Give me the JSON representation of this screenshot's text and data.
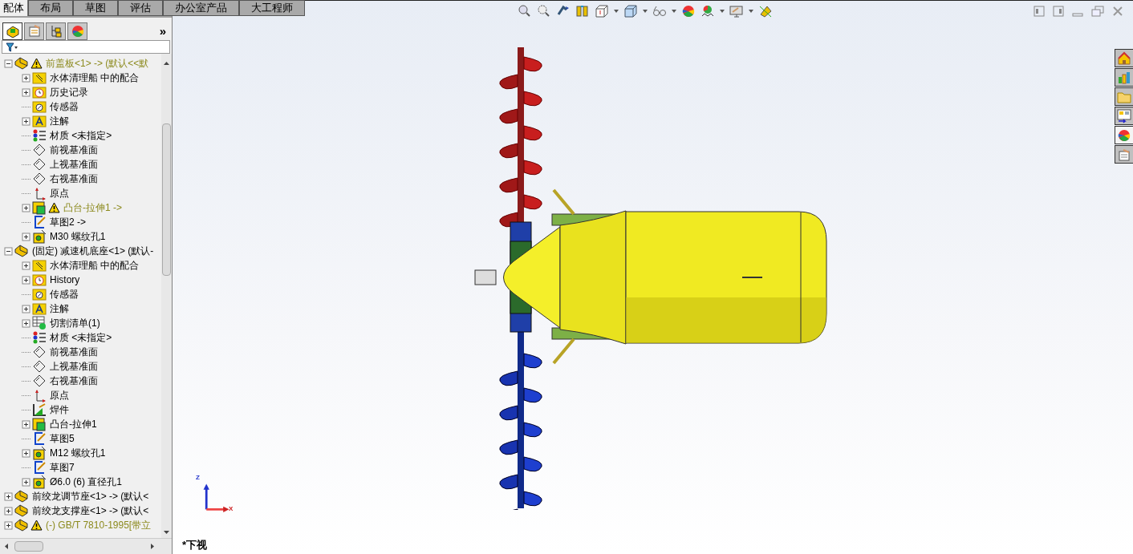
{
  "command_tabs": [
    {
      "label": "配体",
      "selected": true
    },
    {
      "label": "布局",
      "selected": false
    },
    {
      "label": "草图",
      "selected": false
    },
    {
      "label": "评估",
      "selected": false
    },
    {
      "label": "办公室产品",
      "selected": false
    },
    {
      "label": "大工程师",
      "selected": false
    }
  ],
  "manager_tabs": [
    {
      "kind": "feature-tree",
      "selected": true
    },
    {
      "kind": "property",
      "selected": false
    },
    {
      "kind": "configuration",
      "selected": false
    },
    {
      "kind": "appearance",
      "selected": false
    }
  ],
  "manager_more": "»",
  "tree": [
    {
      "kind": "part",
      "label": "前盖板<1> -> (默认<<默",
      "warning": true,
      "expanded": true,
      "children": [
        {
          "kind": "mates",
          "label": "水体清理船 中的配合",
          "expanded": false
        },
        {
          "kind": "history",
          "label": "历史记录",
          "expanded": false
        },
        {
          "kind": "sensor",
          "label": "传感器"
        },
        {
          "kind": "annotation",
          "label": "注解",
          "expanded": false
        },
        {
          "kind": "material",
          "label": "材质 <未指定>"
        },
        {
          "kind": "plane",
          "label": "前视基准面"
        },
        {
          "kind": "plane",
          "label": "上视基准面"
        },
        {
          "kind": "plane",
          "label": "右视基准面"
        },
        {
          "kind": "origin",
          "label": "原点"
        },
        {
          "kind": "boss",
          "label": "凸台-拉伸1 ->",
          "warning": true,
          "expanded": false
        },
        {
          "kind": "sketch",
          "label": "草图2 ->"
        },
        {
          "kind": "hole",
          "label": "M30 螺纹孔1",
          "expanded": false
        }
      ]
    },
    {
      "kind": "part",
      "label": "(固定) 减速机底座<1> (默认-",
      "warning": false,
      "expanded": true,
      "children": [
        {
          "kind": "mates",
          "label": "水体清理船 中的配合",
          "expanded": false
        },
        {
          "kind": "history",
          "label": "History",
          "expanded": false
        },
        {
          "kind": "sensor",
          "label": "传感器"
        },
        {
          "kind": "annotation",
          "label": "注解",
          "expanded": false
        },
        {
          "kind": "cutlist",
          "label": "切割清单(1)",
          "expanded": false
        },
        {
          "kind": "material",
          "label": "材质 <未指定>"
        },
        {
          "kind": "plane",
          "label": "前视基准面"
        },
        {
          "kind": "plane",
          "label": "上视基准面"
        },
        {
          "kind": "plane",
          "label": "右视基准面"
        },
        {
          "kind": "origin",
          "label": "原点"
        },
        {
          "kind": "weldment",
          "label": "焊件"
        },
        {
          "kind": "boss",
          "label": "凸台-拉伸1",
          "expanded": false
        },
        {
          "kind": "sketch",
          "label": "草图5"
        },
        {
          "kind": "hole",
          "label": "M12 螺纹孔1",
          "expanded": false
        },
        {
          "kind": "sketch",
          "label": "草图7"
        },
        {
          "kind": "hole",
          "label": "Ø6.0 (6) 直径孔1",
          "expanded": false
        }
      ]
    },
    {
      "kind": "part",
      "label": "前绞龙调节座<1> -> (默认<",
      "warning": false,
      "expanded": false
    },
    {
      "kind": "part",
      "label": "前绞龙支撑座<1> -> (默认<",
      "warning": false,
      "expanded": false
    },
    {
      "kind": "part",
      "label": "(-) GB/T 7810-1995[带立",
      "warning": true,
      "expanded": false
    }
  ],
  "triad": {
    "z": "Z",
    "x": "X"
  },
  "view_label": "*下视",
  "task_pane": [
    {
      "kind": "home",
      "selected": false
    },
    {
      "kind": "library",
      "selected": false
    },
    {
      "kind": "folder",
      "selected": false
    },
    {
      "kind": "palette",
      "selected": false
    },
    {
      "kind": "appearance",
      "selected": true
    },
    {
      "kind": "properties",
      "selected": false
    }
  ]
}
